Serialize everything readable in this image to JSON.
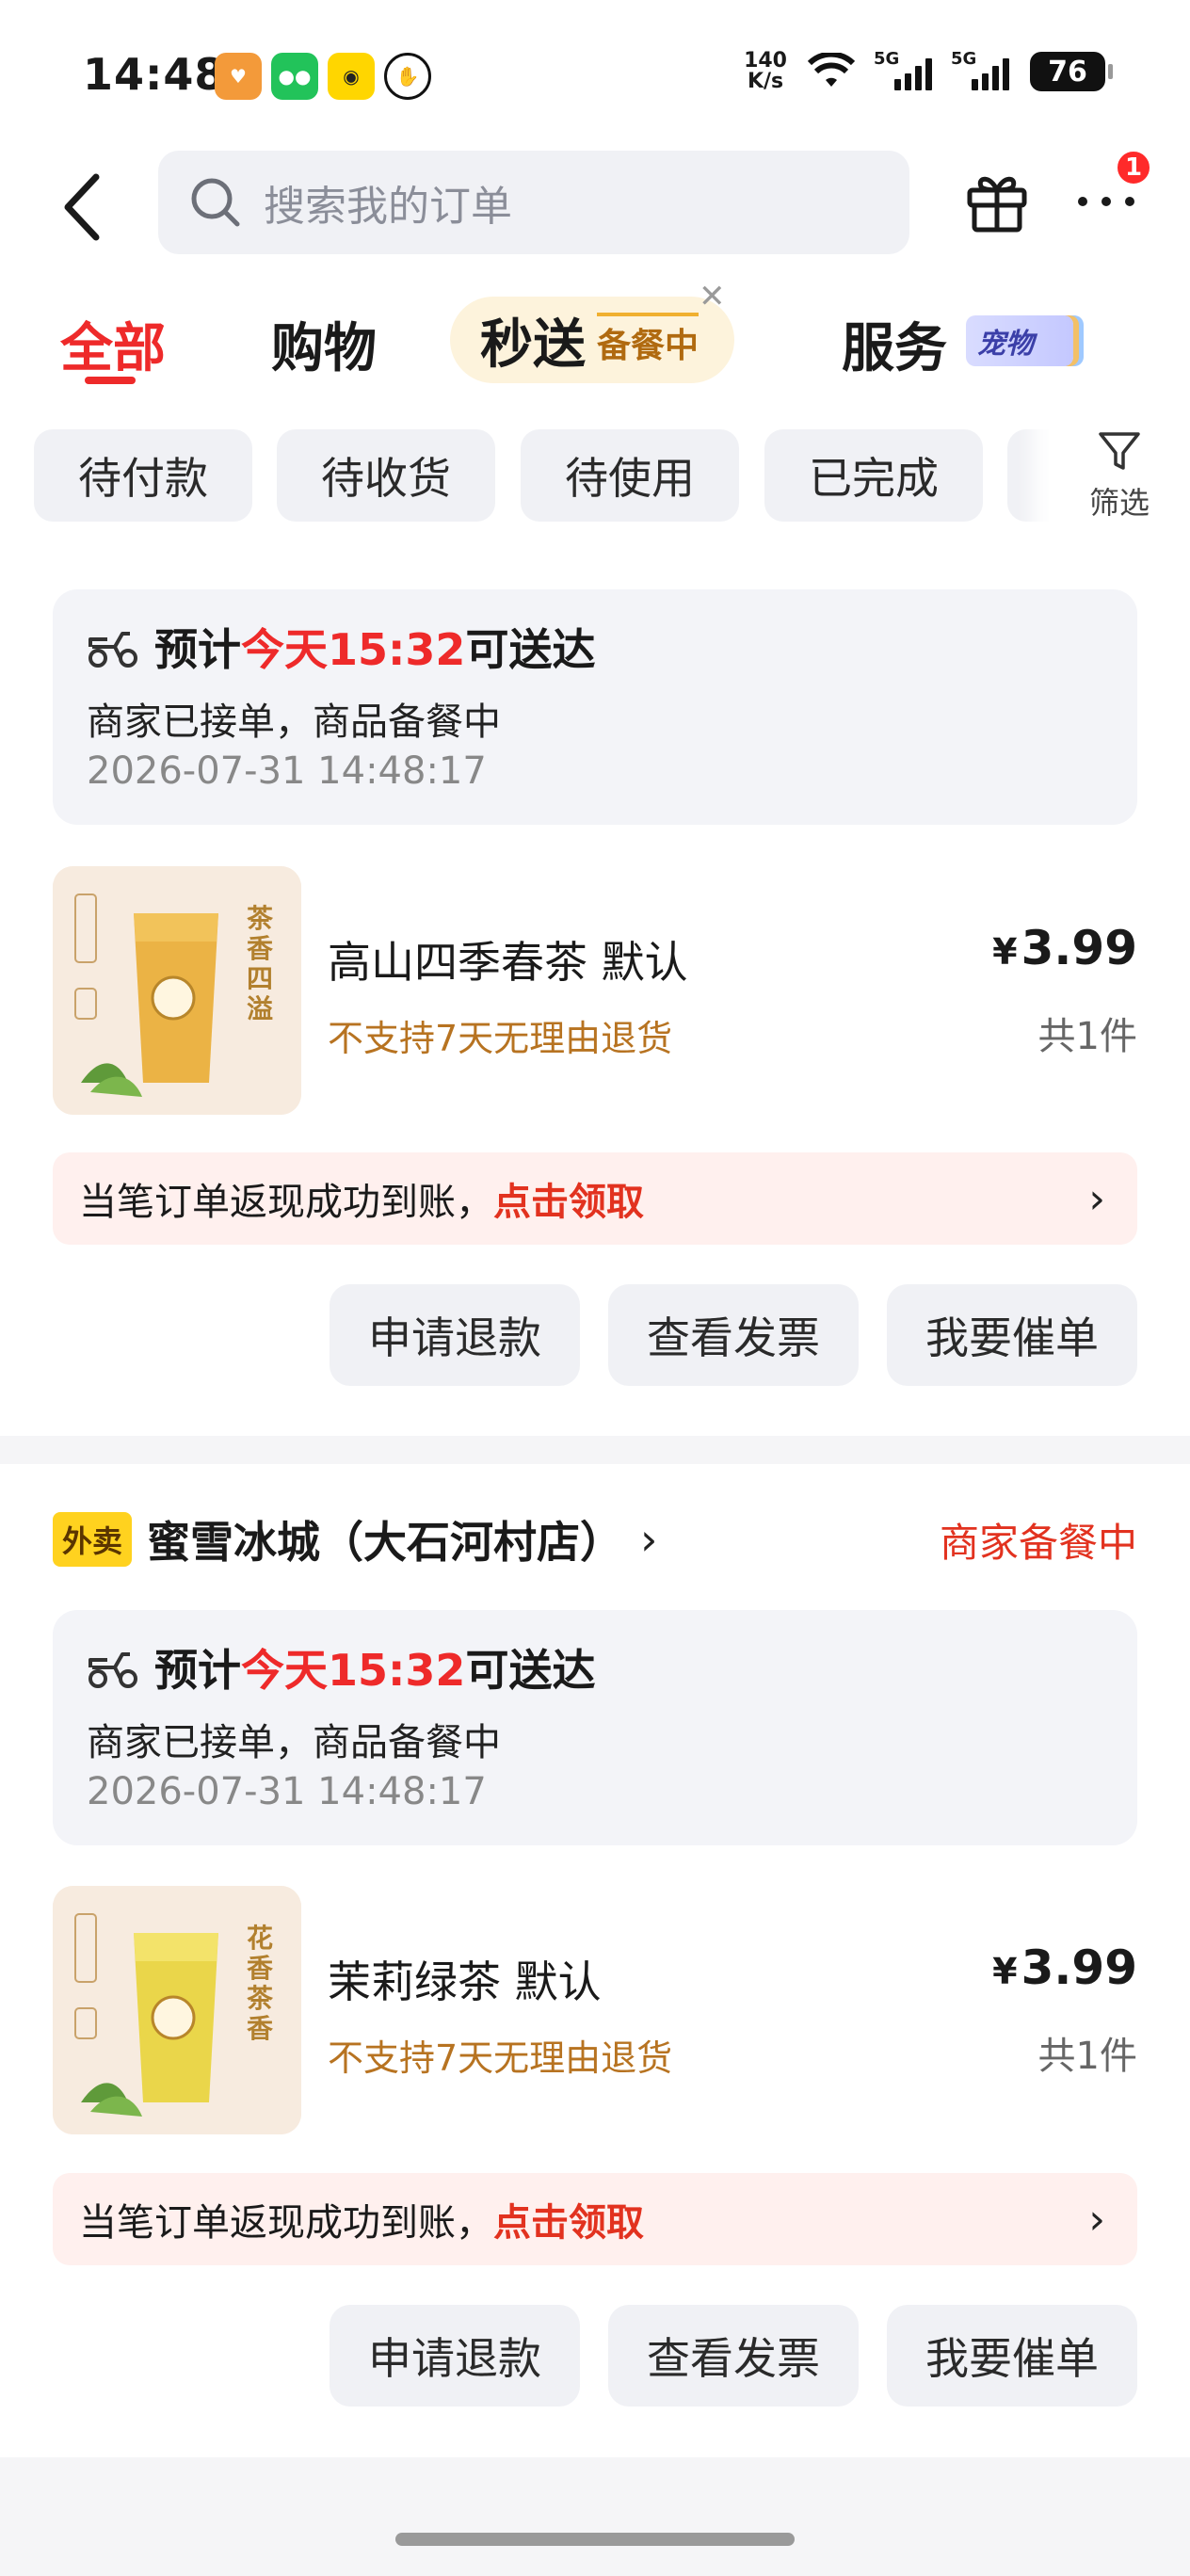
{
  "status_bar": {
    "time": "14:48",
    "net_speed_top": "140",
    "net_speed_bottom": "K/s",
    "signal1": "5G",
    "signal2": "5G",
    "battery": "76"
  },
  "header": {
    "search_placeholder": "搜索我的订单",
    "notification_count": "1"
  },
  "tabs": [
    {
      "label": "全部",
      "active": true
    },
    {
      "label": "购物",
      "active": false
    },
    {
      "label": "秒送",
      "sub": "备餐中",
      "active": false
    },
    {
      "label": "服务",
      "badge": "宠物",
      "active": false
    }
  ],
  "filters": {
    "chips": [
      "待付款",
      "待收货",
      "待使用",
      "已完成"
    ],
    "filter_label": "筛选"
  },
  "orders": [
    {
      "eta_prefix": "预计",
      "eta_highlight": "今天15:32",
      "eta_suffix": "可送达",
      "status_text": "商家已接单，商品备餐中",
      "timestamp": "2026-07-31 14:48:17",
      "product_name": "高山四季春茶 默认",
      "product_note": "不支持7天无理由退货",
      "price_symbol": "¥",
      "price": "3.99",
      "qty": "共1件",
      "thumb_text": "茶香四溢",
      "cashback_text": "当笔订单返现成功到账，",
      "cashback_link": "点击领取",
      "actions": [
        "申请退款",
        "查看发票",
        "我要催单"
      ]
    },
    {
      "store_tag": "外卖",
      "store_name": "蜜雪冰城（大石河村店）",
      "store_status": "商家备餐中",
      "eta_prefix": "预计",
      "eta_highlight": "今天15:32",
      "eta_suffix": "可送达",
      "status_text": "商家已接单，商品备餐中",
      "timestamp": "2026-07-31 14:48:17",
      "product_name": "茉莉绿茶 默认",
      "product_note": "不支持7天无理由退货",
      "price_symbol": "¥",
      "price": "3.99",
      "qty": "共1件",
      "thumb_text": "花香茶香",
      "cashback_text": "当笔订单返现成功到账，",
      "cashback_link": "点击领取",
      "actions": [
        "申请退款",
        "查看发票",
        "我要催单"
      ]
    }
  ],
  "colors": {
    "accent_red": "#ee2a2a",
    "note_brown": "#b77321",
    "chip_bg": "#f0f1f5"
  }
}
